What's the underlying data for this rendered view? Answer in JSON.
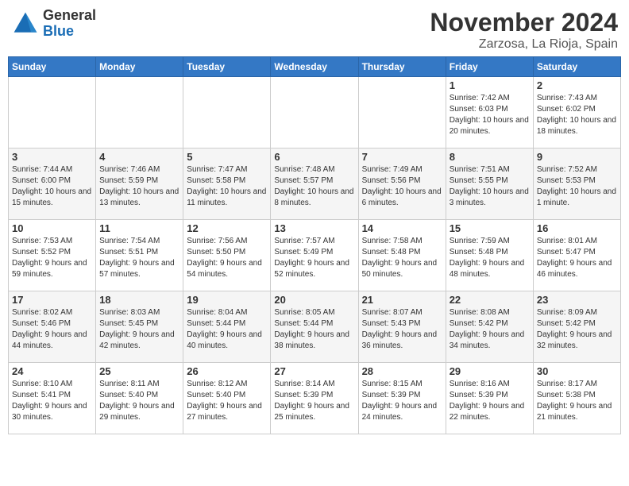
{
  "header": {
    "logo_general": "General",
    "logo_blue": "Blue",
    "month": "November 2024",
    "location": "Zarzosa, La Rioja, Spain"
  },
  "days_of_week": [
    "Sunday",
    "Monday",
    "Tuesday",
    "Wednesday",
    "Thursday",
    "Friday",
    "Saturday"
  ],
  "weeks": [
    {
      "days": [
        {
          "num": "",
          "info": ""
        },
        {
          "num": "",
          "info": ""
        },
        {
          "num": "",
          "info": ""
        },
        {
          "num": "",
          "info": ""
        },
        {
          "num": "",
          "info": ""
        },
        {
          "num": "1",
          "info": "Sunrise: 7:42 AM\nSunset: 6:03 PM\nDaylight: 10 hours and 20 minutes."
        },
        {
          "num": "2",
          "info": "Sunrise: 7:43 AM\nSunset: 6:02 PM\nDaylight: 10 hours and 18 minutes."
        }
      ]
    },
    {
      "days": [
        {
          "num": "3",
          "info": "Sunrise: 7:44 AM\nSunset: 6:00 PM\nDaylight: 10 hours and 15 minutes."
        },
        {
          "num": "4",
          "info": "Sunrise: 7:46 AM\nSunset: 5:59 PM\nDaylight: 10 hours and 13 minutes."
        },
        {
          "num": "5",
          "info": "Sunrise: 7:47 AM\nSunset: 5:58 PM\nDaylight: 10 hours and 11 minutes."
        },
        {
          "num": "6",
          "info": "Sunrise: 7:48 AM\nSunset: 5:57 PM\nDaylight: 10 hours and 8 minutes."
        },
        {
          "num": "7",
          "info": "Sunrise: 7:49 AM\nSunset: 5:56 PM\nDaylight: 10 hours and 6 minutes."
        },
        {
          "num": "8",
          "info": "Sunrise: 7:51 AM\nSunset: 5:55 PM\nDaylight: 10 hours and 3 minutes."
        },
        {
          "num": "9",
          "info": "Sunrise: 7:52 AM\nSunset: 5:53 PM\nDaylight: 10 hours and 1 minute."
        }
      ]
    },
    {
      "days": [
        {
          "num": "10",
          "info": "Sunrise: 7:53 AM\nSunset: 5:52 PM\nDaylight: 9 hours and 59 minutes."
        },
        {
          "num": "11",
          "info": "Sunrise: 7:54 AM\nSunset: 5:51 PM\nDaylight: 9 hours and 57 minutes."
        },
        {
          "num": "12",
          "info": "Sunrise: 7:56 AM\nSunset: 5:50 PM\nDaylight: 9 hours and 54 minutes."
        },
        {
          "num": "13",
          "info": "Sunrise: 7:57 AM\nSunset: 5:49 PM\nDaylight: 9 hours and 52 minutes."
        },
        {
          "num": "14",
          "info": "Sunrise: 7:58 AM\nSunset: 5:48 PM\nDaylight: 9 hours and 50 minutes."
        },
        {
          "num": "15",
          "info": "Sunrise: 7:59 AM\nSunset: 5:48 PM\nDaylight: 9 hours and 48 minutes."
        },
        {
          "num": "16",
          "info": "Sunrise: 8:01 AM\nSunset: 5:47 PM\nDaylight: 9 hours and 46 minutes."
        }
      ]
    },
    {
      "days": [
        {
          "num": "17",
          "info": "Sunrise: 8:02 AM\nSunset: 5:46 PM\nDaylight: 9 hours and 44 minutes."
        },
        {
          "num": "18",
          "info": "Sunrise: 8:03 AM\nSunset: 5:45 PM\nDaylight: 9 hours and 42 minutes."
        },
        {
          "num": "19",
          "info": "Sunrise: 8:04 AM\nSunset: 5:44 PM\nDaylight: 9 hours and 40 minutes."
        },
        {
          "num": "20",
          "info": "Sunrise: 8:05 AM\nSunset: 5:44 PM\nDaylight: 9 hours and 38 minutes."
        },
        {
          "num": "21",
          "info": "Sunrise: 8:07 AM\nSunset: 5:43 PM\nDaylight: 9 hours and 36 minutes."
        },
        {
          "num": "22",
          "info": "Sunrise: 8:08 AM\nSunset: 5:42 PM\nDaylight: 9 hours and 34 minutes."
        },
        {
          "num": "23",
          "info": "Sunrise: 8:09 AM\nSunset: 5:42 PM\nDaylight: 9 hours and 32 minutes."
        }
      ]
    },
    {
      "days": [
        {
          "num": "24",
          "info": "Sunrise: 8:10 AM\nSunset: 5:41 PM\nDaylight: 9 hours and 30 minutes."
        },
        {
          "num": "25",
          "info": "Sunrise: 8:11 AM\nSunset: 5:40 PM\nDaylight: 9 hours and 29 minutes."
        },
        {
          "num": "26",
          "info": "Sunrise: 8:12 AM\nSunset: 5:40 PM\nDaylight: 9 hours and 27 minutes."
        },
        {
          "num": "27",
          "info": "Sunrise: 8:14 AM\nSunset: 5:39 PM\nDaylight: 9 hours and 25 minutes."
        },
        {
          "num": "28",
          "info": "Sunrise: 8:15 AM\nSunset: 5:39 PM\nDaylight: 9 hours and 24 minutes."
        },
        {
          "num": "29",
          "info": "Sunrise: 8:16 AM\nSunset: 5:39 PM\nDaylight: 9 hours and 22 minutes."
        },
        {
          "num": "30",
          "info": "Sunrise: 8:17 AM\nSunset: 5:38 PM\nDaylight: 9 hours and 21 minutes."
        }
      ]
    }
  ]
}
